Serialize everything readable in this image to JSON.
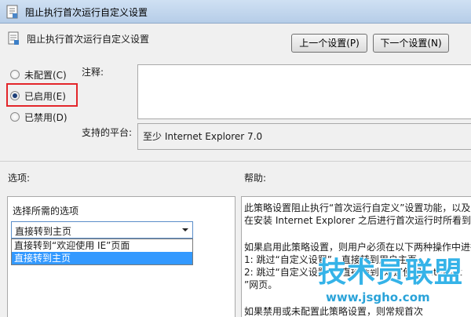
{
  "window": {
    "title": "阻止执行首次运行自定义设置",
    "icon": "policy-setting-icon"
  },
  "header": {
    "policy_name": "阻止执行首次运行自定义设置",
    "prev_label": "上一个设置(P)",
    "next_label": "下一个设置(N)"
  },
  "state": {
    "options": [
      {
        "label": "未配置(C)",
        "selected": false
      },
      {
        "label": "已启用(E)",
        "selected": true
      },
      {
        "label": "已禁用(D)",
        "selected": false
      }
    ],
    "highlight_color": "#e3262b"
  },
  "comment": {
    "label": "注释:",
    "value": ""
  },
  "platform": {
    "label": "支持的平台:",
    "value": "至少 Internet Explorer 7.0"
  },
  "sections": {
    "options_label": "选项:",
    "help_label": "帮助:"
  },
  "options_panel": {
    "title": "选择所需的选项",
    "selected_value": "直接转到主页",
    "dropdown_items": [
      {
        "label": "直接转到“欢迎使用 IE”页面",
        "highlighted": false
      },
      {
        "label": "直接转到主页",
        "highlighted": true
      }
    ],
    "highlight_color": "#3399ff"
  },
  "help": {
    "lines": [
      "此策略设置阻止执行“首次运行自定义”设置功能，以及",
      "在安装 Internet Explorer 之后进行首次运行时所看到的",
      "如果启用此策略设置，则用户必须在以下两种操作中进行",
      "1: 跳过“自定义设置”，直接转到用户主页。",
      "2: 跳过“自定义设置”，直接转到“欢迎使用 Internet",
      "”网页。",
      "如果禁用或未配置此策略设置，则常规首次"
    ]
  },
  "watermark": {
    "text": "技术员联盟",
    "url": "www.jsgho.com",
    "color": "#35b3e8"
  }
}
